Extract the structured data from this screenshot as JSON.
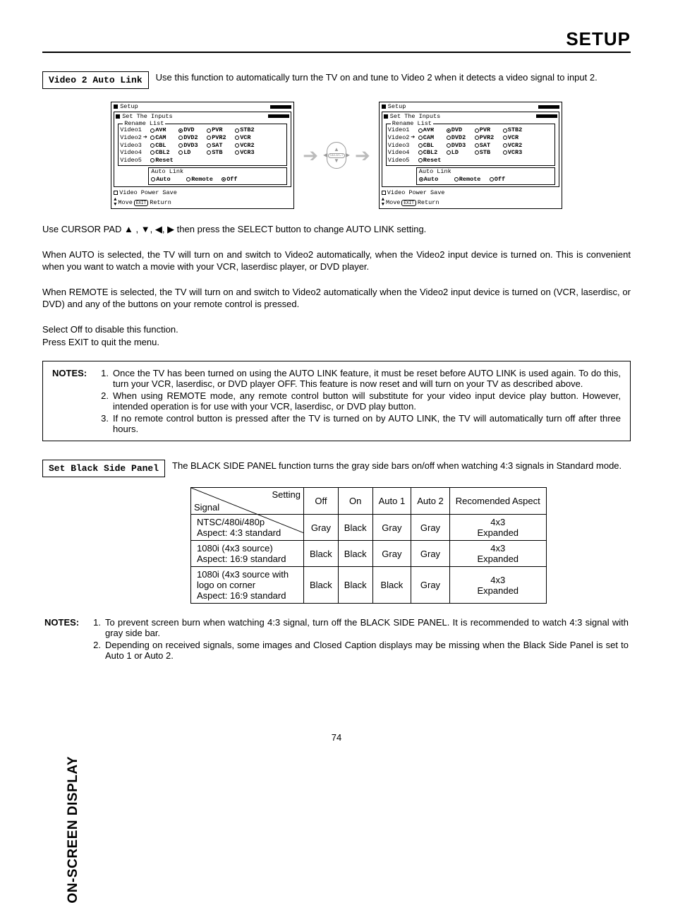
{
  "header": {
    "title": "SETUP"
  },
  "sideLabel": "ON-SCREEN DISPLAY",
  "section1": {
    "label": "Video 2 Auto Link",
    "intro": "Use this function to automatically turn the TV on and tune to Video 2 when it detects a video signal to input 2."
  },
  "osd": {
    "title": "Setup",
    "subtitle": "Set The Inputs",
    "legend": "Rename List",
    "videoLabels": [
      "Video1",
      "Video2",
      "Video3",
      "Video4",
      "Video5"
    ],
    "options": [
      [
        "AVR",
        "DVD",
        "PVR",
        "STB2"
      ],
      [
        "CAM",
        "DVD2",
        "PVR2",
        "VCR"
      ],
      [
        "CBL",
        "DVD3",
        "SAT",
        "VCR2"
      ],
      [
        "CBL2",
        "LD",
        "STB",
        "VCR3"
      ],
      [
        "Reset",
        "",
        "",
        ""
      ]
    ],
    "autoLink": {
      "title": "Auto Link",
      "auto": "Auto",
      "remote": "Remote",
      "off": "Off"
    },
    "powerSave": "Video Power Save",
    "footer": {
      "move": "Move",
      "ret": "Return"
    }
  },
  "bodyParagraphs": [
    "Use CURSOR PAD ▲ , ▼, ◀, ▶ then press the SELECT button to change AUTO LINK setting.",
    "When AUTO  is selected, the TV will turn on and switch to Video2 automatically, when the Video2 input device is turned on. This is convenient when you want to watch a movie with your VCR, laserdisc player, or DVD player.",
    "When REMOTE is selected, the TV will turn on and switch to Video2 automatically when the Video2 input device is turned on (VCR, laserdisc, or DVD) and any of the buttons on your remote control is pressed.",
    "Select Off to disable this function.\nPress EXIT to quit the menu."
  ],
  "notes1": {
    "label": "NOTES:",
    "items": [
      "Once the TV has been turned on using the AUTO LINK feature, it must be reset before AUTO LINK is used again. To do this, turn your VCR, laserdisc, or DVD player OFF. This feature is now reset and will turn on your TV as described above.",
      "When using REMOTE mode, any remote control button will substitute for your video input device play button. However, intended operation is for use with your VCR, laserdisc, or DVD play button.",
      "If no remote control button is pressed after the TV is turned on by AUTO LINK, the TV will automatically turn off after three hours."
    ]
  },
  "section2": {
    "label": "Set Black Side Panel",
    "intro": "The BLACK SIDE PANEL function turns the gray side bars on/off when watching 4:3 signals in Standard mode."
  },
  "table": {
    "cornerSetting": "Setting",
    "cornerSignal": "Signal",
    "cols": [
      "Off",
      "On",
      "Auto 1",
      "Auto 2",
      "Recomended Aspect"
    ],
    "rows": [
      {
        "signal": "NTSC/480i/480p\nAspect: 4:3 standard",
        "cells": [
          "Gray",
          "Black",
          "Gray",
          "Gray",
          "4x3\nExpanded"
        ]
      },
      {
        "signal": "1080i (4x3 source)\nAspect: 16:9 standard",
        "cells": [
          "Black",
          "Black",
          "Gray",
          "Gray",
          "4x3\nExpanded"
        ]
      },
      {
        "signal": "1080i (4x3 source with logo on corner\nAspect: 16:9 standard",
        "cells": [
          "Black",
          "Black",
          "Black",
          "Gray",
          "4x3\nExpanded"
        ]
      }
    ]
  },
  "notes2": {
    "label": "NOTES:",
    "items": [
      "To prevent screen burn when watching 4:3 signal, turn off the BLACK SIDE PANEL.  It is recommended to watch 4:3 signal with gray side bar.",
      "Depending on received signals, some images and Closed Caption displays may be missing when the Black Side Panel is set to Auto 1 or Auto 2."
    ]
  },
  "pageNumber": "74"
}
